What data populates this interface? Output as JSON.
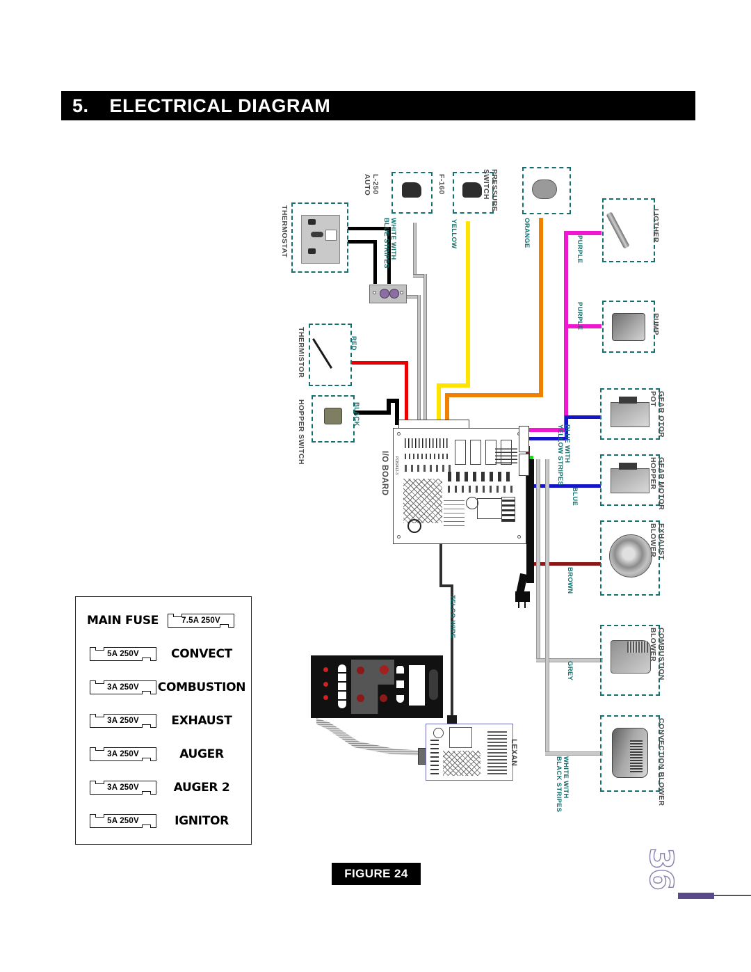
{
  "section": {
    "number": "5.",
    "title": "ELECTRICAL DIAGRAM"
  },
  "figure": {
    "caption": "FIGURE 24"
  },
  "page": {
    "number": "36"
  },
  "fuse_table": {
    "rows": [
      {
        "name": "MAIN FUSE",
        "rating": "7.5A   250V",
        "layout": "name-first"
      },
      {
        "name": "CONVECT",
        "rating": "5A   250V",
        "layout": "chip-first"
      },
      {
        "name": "COMBUSTION",
        "rating": "3A   250V",
        "layout": "chip-first"
      },
      {
        "name": "EXHAUST",
        "rating": "3A   250V",
        "layout": "chip-first"
      },
      {
        "name": "AUGER",
        "rating": "3A   250V",
        "layout": "chip-first"
      },
      {
        "name": "AUGER 2",
        "rating": "3A   250V",
        "layout": "chip-first"
      },
      {
        "name": "IGNITOR",
        "rating": "5A   250V",
        "layout": "chip-first"
      }
    ]
  },
  "diagram": {
    "components": [
      {
        "id": "thermostat",
        "label": "THERMOSTAT"
      },
      {
        "id": "l250-auto",
        "label": "L-250\nAUTO"
      },
      {
        "id": "f160",
        "label": "F-160"
      },
      {
        "id": "pressure-switch",
        "label": "PRESSURE\nSWITCH"
      },
      {
        "id": "ligther",
        "label": "LIGTHER"
      },
      {
        "id": "pump",
        "label": "PUMP"
      },
      {
        "id": "thermistor",
        "label": "THERMISTOR"
      },
      {
        "id": "hopper-switch",
        "label": "HOPPER SWITCH"
      },
      {
        "id": "gear-motor-pot",
        "label": "GEAR OTOR\nPOT"
      },
      {
        "id": "gear-motor-hopper",
        "label": "GEAR MOTOR\nHOPPER"
      },
      {
        "id": "exhaust-blower",
        "label": "EXHAUST\nBLOWER"
      },
      {
        "id": "combustion-blower",
        "label": "COMBUSTION\nBLOWER"
      },
      {
        "id": "convection-blower",
        "label": "CONVECTION BLOWER"
      },
      {
        "id": "io-board",
        "label": "I/O BOARD"
      },
      {
        "id": "lexan",
        "label": "LEXAN"
      }
    ],
    "wire_labels": [
      {
        "id": "white-blue-stripes",
        "label": "WHITE WITH\nBLUE STRIPES",
        "color": "#b9b9b9"
      },
      {
        "id": "yellow",
        "label": "YELLOW",
        "color": "#ffe400"
      },
      {
        "id": "orange",
        "label": "ORANGE",
        "color": "#f08000"
      },
      {
        "id": "purple-ligther",
        "label": "PURPLE",
        "color": "#ef17d0"
      },
      {
        "id": "purple-pump",
        "label": "PURPLE",
        "color": "#ef17d0"
      },
      {
        "id": "red",
        "label": "RED",
        "color": "#e90000"
      },
      {
        "id": "black",
        "label": "BLACK",
        "color": "#000000"
      },
      {
        "id": "blue-yellow-stripes",
        "label": "BLUE WITH\nYELLOW STRIPES",
        "color": "#1414c8"
      },
      {
        "id": "blue",
        "label": "BLUE",
        "color": "#1414c8"
      },
      {
        "id": "brown",
        "label": "BROWN",
        "color": "#8d1616"
      },
      {
        "id": "grey",
        "label": "GREY",
        "color": "#b9b9b9"
      },
      {
        "id": "white-black-stripes",
        "label": "WHITE WITH\nBLACK STRIPES",
        "color": "#b9b9b9"
      },
      {
        "id": "telco-wire",
        "label": "TELCO WIRE",
        "color": "#333333"
      }
    ],
    "board_silkscreen": "PCB2412-3",
    "accent_color": "#14706f"
  }
}
